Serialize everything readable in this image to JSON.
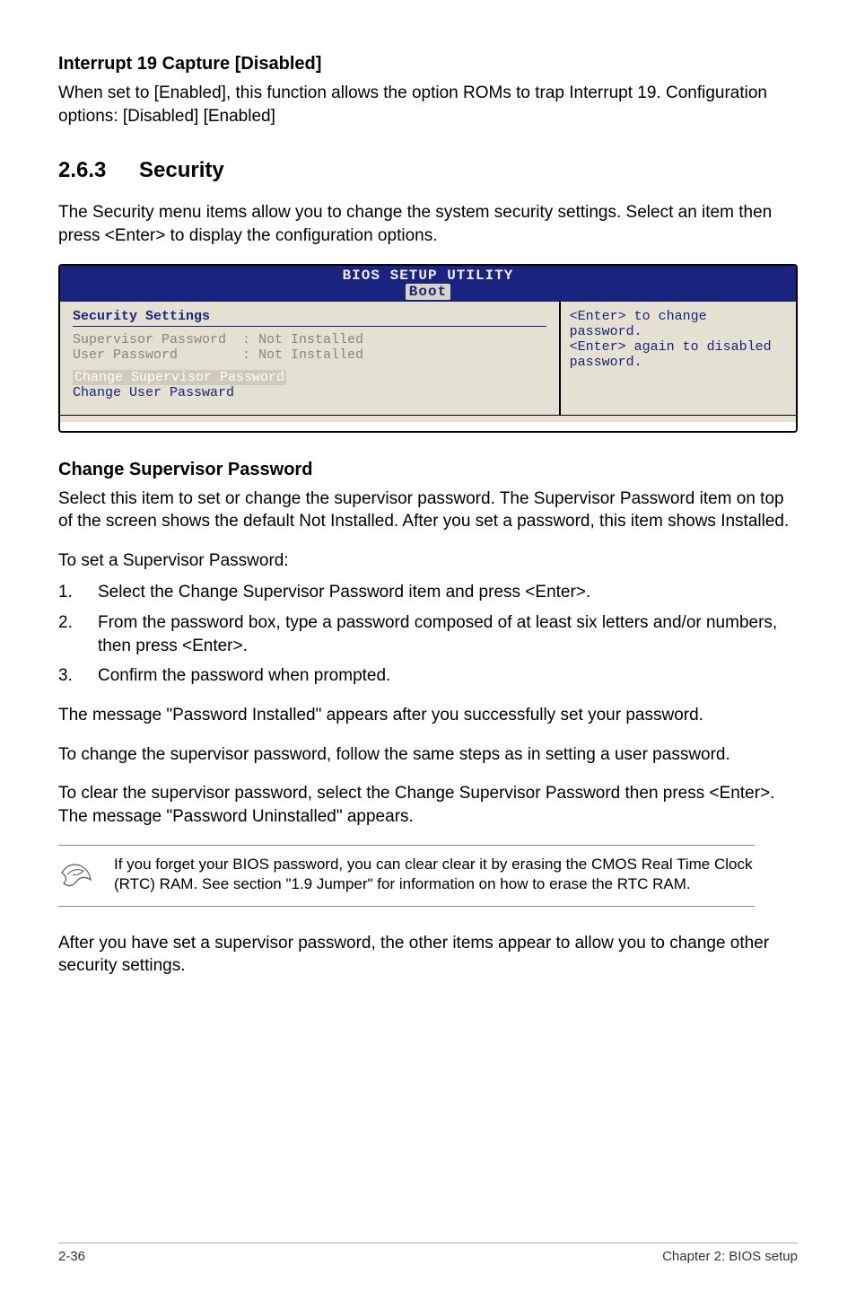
{
  "sec1": {
    "heading": "Interrupt 19 Capture [Disabled]",
    "para": "When set to [Enabled], this function allows the option ROMs to trap Interrupt 19. Configuration options: [Disabled] [Enabled]"
  },
  "section": {
    "num": "2.6.3",
    "title": "Security"
  },
  "intro": "The Security menu items allow you to change the system security settings. Select an item then press <Enter> to display the configuration options.",
  "bios": {
    "title": "BIOS SETUP UTILITY",
    "tab": "Boot",
    "heading": "Security Settings",
    "row1a": "Supervisor Password  : Not Installed",
    "row1b": "User Password        : Not Installed",
    "sel": "Change Supervisor Password",
    "link": "Change User Passward",
    "help": "<Enter> to change password.\n<Enter> again to disabled password."
  },
  "csp": {
    "heading": "Change Supervisor Password",
    "p1": "Select this item to set or change the supervisor password. The Supervisor Password item on top of the screen shows the default Not Installed. After you set a password, this item shows Installed.",
    "p2": "To set a Supervisor Password:",
    "steps": [
      "Select the Change Supervisor Password item and press <Enter>.",
      "From the password box, type a password composed of at least six letters and/or numbers, then press <Enter>.",
      "Confirm the password when prompted."
    ],
    "p3": "The message \"Password Installed\" appears after you successfully set your password.",
    "p4": "To change the supervisor password, follow the same steps as in setting a user password.",
    "p5": "To clear the supervisor password, select the Change Supervisor Password then press <Enter>. The message \"Password Uninstalled\" appears.",
    "note": "If you forget your BIOS password, you can clear clear it by erasing the CMOS Real Time Clock (RTC) RAM. See section \"1.9 Jumper\" for information on how to erase the RTC RAM.",
    "p6": "After you have set a supervisor password, the other items appear to allow you to change other security settings."
  },
  "footer": {
    "left": "2-36",
    "right": "Chapter 2: BIOS setup"
  }
}
